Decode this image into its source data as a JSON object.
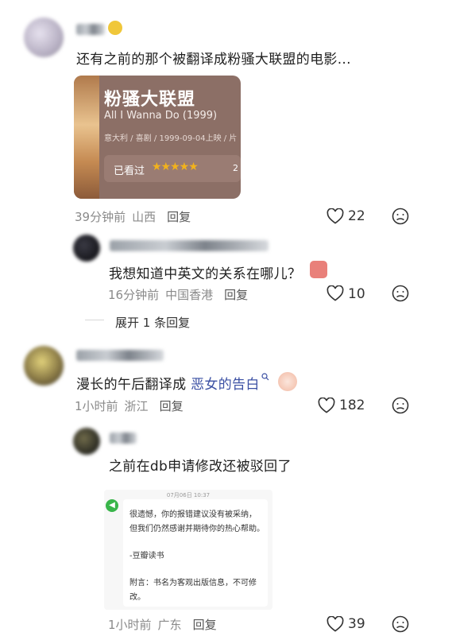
{
  "comments": [
    {
      "text": "还有之前的那个被翻译成粉骚大联盟的电影...",
      "time": "39分钟前",
      "location": "山西",
      "reply": "回复",
      "likes": "22"
    },
    {
      "text": "我想知道中英文的关系在哪儿？",
      "time": "16分钟前",
      "location": "中国香港",
      "reply": "回复",
      "likes": "10"
    },
    {
      "expand": "展开 1 条回复"
    },
    {
      "text_a": "漫长的午后翻译成",
      "text_link": "恶女的告白",
      "time": "1小时前",
      "location": "浙江",
      "reply": "回复",
      "likes": "182"
    },
    {
      "text": "之前在db申请修改还被驳回了",
      "time": "1小时前",
      "location": "广东",
      "reply": "回复",
      "likes": "39"
    }
  ],
  "movie_card": {
    "title": "粉骚大联盟",
    "subtitle": "All I Wanna Do (1999)",
    "info": "意大利 / 喜剧 / 1999-09-04上映 / 片",
    "rating_label": "已看过",
    "stars": "★★★★★",
    "rating_num": "2"
  },
  "notice": {
    "date": "07月06日 10:37",
    "line1": "很遗憾，你的报错建议没有被采纳，",
    "line2": "但我们仍然感谢并期待你的热心帮助。",
    "line3": "-豆瓣读书",
    "line4": "附言：书名为客观出版信息，不可修",
    "line5": "改。"
  },
  "colors": {
    "link": "#3a4fa3",
    "meta": "#8a8a8a",
    "star": "#f2b21c",
    "card_bg": "#8c6f66"
  }
}
